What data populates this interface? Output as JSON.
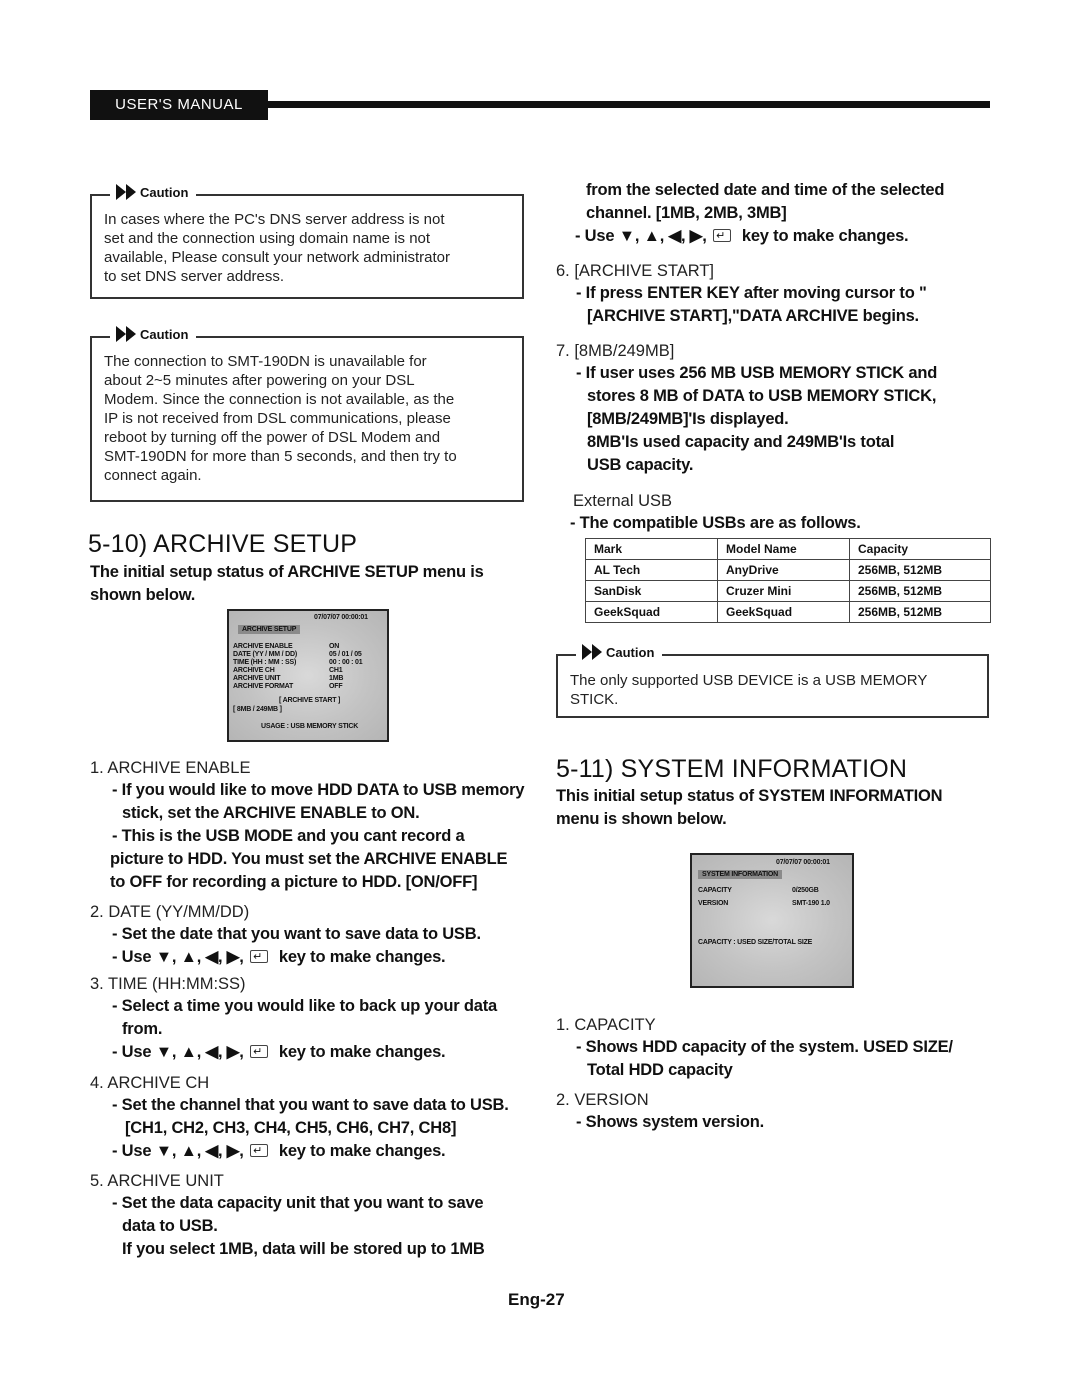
{
  "header": {
    "label": "USER'S MANUAL"
  },
  "left": {
    "caution1": {
      "title": "Caution",
      "lines": [
        "In cases where the PC's DNS server address is not",
        "set and the connection using domain name is not",
        "available, Please consult your network administrator",
        "to set DNS server address."
      ]
    },
    "caution2": {
      "title": "Caution",
      "lines": [
        "The connection to SMT-190DN is unavailable for",
        "about 2~5 minutes after powering on your DSL",
        "Modem. Since the connection is not available, as the",
        "IP is not received from DSL communications, please",
        "reboot by turning off the power of DSL Modem and",
        "SMT-190DN for more than 5 seconds, and then try to",
        "connect again."
      ]
    },
    "section_title": "5-10) ARCHIVE SETUP",
    "intro_lines": [
      "The initial setup status of ARCHIVE SETUP menu is",
      "shown below."
    ],
    "archive_screen": {
      "datetime": "07/07/07  00:00:01",
      "title": "ARCHIVE SETUP",
      "rows": [
        {
          "label": "ARCHIVE ENABLE",
          "value": "ON"
        },
        {
          "label": "DATE (YY / MM / DD)",
          "value": "05 / 01 / 05"
        },
        {
          "label": "TIME (HH : MM : SS)",
          "value": "00 : 00 : 01"
        },
        {
          "label": "ARCHIVE CH",
          "value": "CH1"
        },
        {
          "label": "ARCHIVE UNIT",
          "value": "1MB"
        },
        {
          "label": "ARCHIVE FORMAT",
          "value": "OFF"
        }
      ],
      "start": "[ ARCHIVE START ]",
      "usage_cap": "[ 8MB / 249MB ]",
      "usage": "USAGE : USB MEMORY STICK"
    },
    "items": [
      {
        "heading": "1. ARCHIVE ENABLE",
        "lines": [
          "- If you would like to move HDD DATA to USB memory",
          "stick, set the ARCHIVE ENABLE to ON.",
          "- This is the USB MODE and you cant record a",
          "picture to HDD. You must set the ARCHIVE ENABLE",
          "to OFF for recording a picture to HDD. [ON/OFF]"
        ]
      },
      {
        "heading": "2. DATE (YY/MM/DD)",
        "lines": [
          "- Set the date that you want to save data to USB."
        ],
        "keys": "- Use ▼, ▲, ◀, ▶,",
        "keys_tail": "key to make changes."
      },
      {
        "heading": "3. TIME (HH:MM:SS)",
        "lines": [
          "- Select a time you would like to back up your data",
          "from."
        ],
        "keys": "- Use ▼, ▲, ◀, ▶,",
        "keys_tail": "key to make changes."
      },
      {
        "heading": "4. ARCHIVE CH",
        "lines": [
          "- Set the channel that you want to save data to USB.",
          "[CH1, CH2, CH3, CH4, CH5, CH6, CH7, CH8]"
        ],
        "keys": "- Use ▼, ▲, ◀, ▶,",
        "keys_tail": "key to make changes."
      },
      {
        "heading": "5. ARCHIVE UNIT",
        "lines": [
          "- Set the data capacity unit that you want to save",
          "data to USB.",
          "If you select 1MB, data will be stored up to 1MB"
        ]
      }
    ]
  },
  "right": {
    "cont_lines": [
      "from the selected date and time of the selected",
      "channel. [1MB, 2MB, 3MB]"
    ],
    "cont_keys": "- Use ▼, ▲, ◀, ▶,",
    "cont_keys_tail": "key to make changes.",
    "item6": {
      "heading": "6. [ARCHIVE START]",
      "lines": [
        "- If press ENTER KEY after moving cursor to \"",
        "[ARCHIVE START],\"DATA  ARCHIVE begins."
      ]
    },
    "item7": {
      "heading": "7. [8MB/249MB]",
      "lines": [
        "- If user uses 256 MB USB MEMORY STICK and",
        "stores 8 MB of DATA to USB MEMORY STICK,",
        "[8MB/249MB]'Is displayed.",
        "8MB'Is used capacity and 249MB'Is total",
        " USB capacity."
      ]
    },
    "external_usb": {
      "heading": "External USB",
      "line": "- The compatible USBs are as follows."
    },
    "usb_table": {
      "headers": [
        "Mark",
        "Model Name",
        "Capacity"
      ],
      "rows": [
        [
          "AL Tech",
          "AnyDrive",
          "256MB, 512MB"
        ],
        [
          "SanDisk",
          "Cruzer Mini",
          "256MB, 512MB"
        ],
        [
          "GeekSquad",
          "GeekSquad",
          "256MB, 512MB"
        ]
      ]
    },
    "caution3": {
      "title": "Caution",
      "lines": [
        "The only supported USB DEVICE is a USB MEMORY",
        "STICK."
      ]
    },
    "section_title": "5-11) SYSTEM INFORMATION",
    "intro_lines": [
      "This initial setup status of SYSTEM INFORMATION",
      "menu is shown below."
    ],
    "sys_screen": {
      "datetime": "07/07/07  00:00:01",
      "title": "SYSTEM INFORMATION",
      "rows": [
        {
          "label": "CAPACITY",
          "value": "0/250GB"
        },
        {
          "label": "VERSION",
          "value": "SMT-190 1.0"
        }
      ],
      "note": "CAPACITY : USED SIZE/TOTAL SIZE"
    },
    "items": [
      {
        "heading": "1. CAPACITY",
        "lines": [
          "- Shows HDD capacity of the system. USED SIZE/",
          "Total HDD capacity"
        ]
      },
      {
        "heading": "2. VERSION",
        "lines": [
          "- Shows system version."
        ]
      }
    ]
  },
  "footer": {
    "page": "Eng-27"
  }
}
